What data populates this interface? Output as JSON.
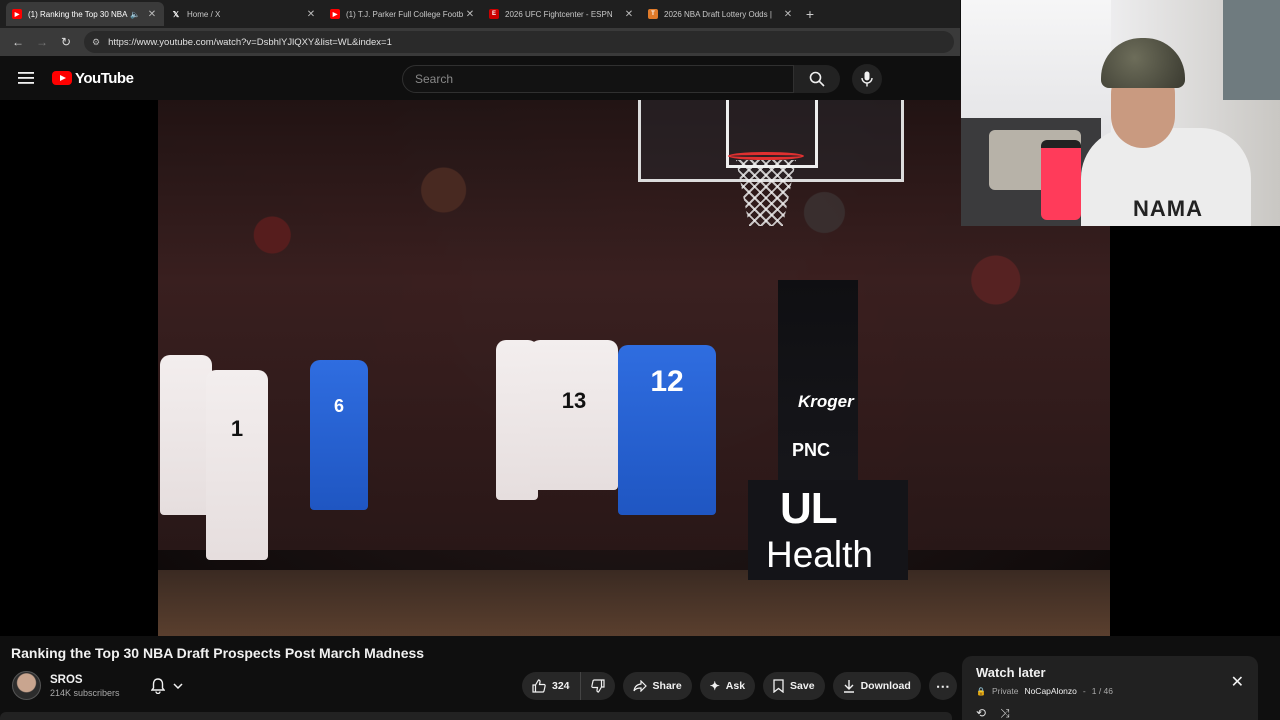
{
  "browser": {
    "tabs": [
      {
        "label": "(1) Ranking the Top 30 NBA",
        "favicon": "youtube-icon",
        "active": true,
        "muted_icon": "speaker-icon"
      },
      {
        "label": "Home / X",
        "favicon": "x-icon",
        "active": false
      },
      {
        "label": "(1) T.J. Parker Full College Footb",
        "favicon": "youtube-icon",
        "active": false
      },
      {
        "label": "2026 UFC Fightcenter - ESPN",
        "favicon": "espn-icon",
        "active": false
      },
      {
        "label": "2026 NBA Draft Lottery Odds |",
        "favicon": "tankathon-icon",
        "active": false
      }
    ],
    "url": "https://www.youtube.com/watch?v=DsbhlYJlQXY&list=WL&index=1"
  },
  "youtube": {
    "logo_text": "YouTube",
    "search_placeholder": "Search"
  },
  "video": {
    "sponsor_1": "Kroger",
    "sponsor_2": "PNC",
    "sponsor_3a": "UL",
    "sponsor_3b": "Health",
    "jersey_numbers": [
      "1",
      "6",
      "13",
      "12"
    ],
    "webcam_shirt_text": "NAMA"
  },
  "video_info": {
    "title": "Ranking the Top 30 NBA Draft Prospects Post March Madness",
    "channel_name": "SROS",
    "subscribers": "214K subscribers",
    "like_count": "324",
    "share_label": "Share",
    "ask_label": "Ask",
    "save_label": "Save",
    "download_label": "Download"
  },
  "playlist": {
    "title": "Watch later",
    "privacy": "Private",
    "owner": "NoCapAlonzo",
    "position": "1 / 46"
  },
  "colors": {
    "youtube_red": "#ff0000",
    "louisville_red": "#c8102e",
    "duke_blue": "#1f56c2"
  }
}
